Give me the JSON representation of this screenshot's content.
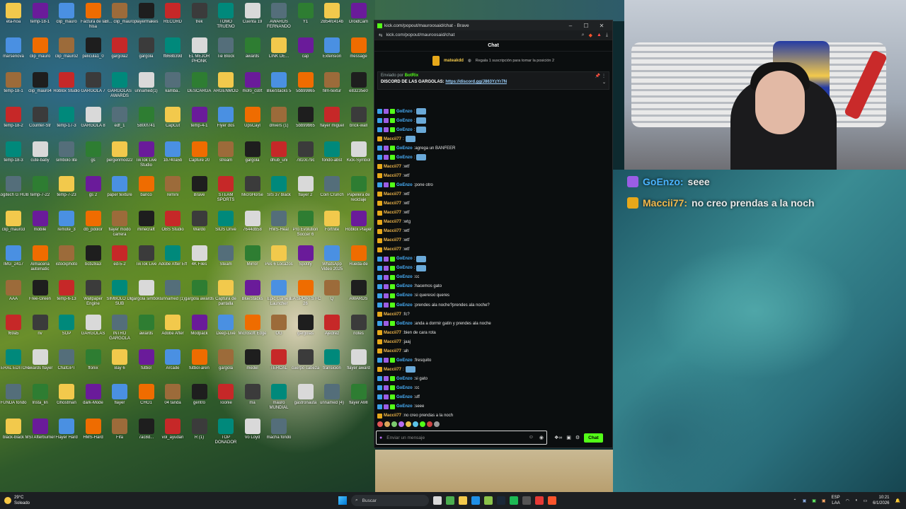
{
  "browser": {
    "window_title": "kick.com/popout/mauroosaid/chat - Brave",
    "url": "kick.com/popout/mauroosaid/chat",
    "chat_title": "Chat",
    "gift": {
      "user": "mateakdd",
      "text": "Regala 1 suscripción para tomar la posición 2"
    },
    "pinned": {
      "by_label": "Enviado por",
      "by_user": "BotRix",
      "text": "DISCORD DE LAS GARGOLAS:",
      "link": "https://discord.gg/J863YzYr7N"
    },
    "input_placeholder": "Enviar un mensaje",
    "send_label": "Chat"
  },
  "messages": [
    {
      "user": "GoEnzo",
      "color": "#4ab3ff",
      "text": "",
      "emote": true
    },
    {
      "user": "GoEnzo",
      "color": "#4ab3ff",
      "text": "",
      "emote": true
    },
    {
      "user": "GoEnzo",
      "color": "#4ab3ff",
      "text": "",
      "emote": true
    },
    {
      "user": "Maccii77",
      "color": "#f2b84b",
      "text": "",
      "emote": true
    },
    {
      "user": "GoEnzo",
      "color": "#4ab3ff",
      "text": "agrega un BANFEER",
      "emote": false
    },
    {
      "user": "GoEnzo",
      "color": "#4ab3ff",
      "text": "",
      "emote": true
    },
    {
      "user": "Maccii77",
      "color": "#f2b84b",
      "text": "wtf",
      "emote": false
    },
    {
      "user": "Maccii77",
      "color": "#f2b84b",
      "text": "wtf",
      "emote": false
    },
    {
      "user": "GoEnzo",
      "color": "#4ab3ff",
      "text": "pone otro",
      "emote": false
    },
    {
      "user": "Maccii77",
      "color": "#f2b84b",
      "text": "wtf",
      "emote": false
    },
    {
      "user": "Maccii77",
      "color": "#f2b84b",
      "text": "wtf",
      "emote": false
    },
    {
      "user": "Maccii77",
      "color": "#f2b84b",
      "text": "wtf",
      "emote": false
    },
    {
      "user": "Maccii77",
      "color": "#f2b84b",
      "text": "wtg",
      "emote": false
    },
    {
      "user": "Maccii77",
      "color": "#f2b84b",
      "text": "wtf",
      "emote": false
    },
    {
      "user": "Maccii77",
      "color": "#f2b84b",
      "text": "wtf",
      "emote": false
    },
    {
      "user": "Maccii77",
      "color": "#f2b84b",
      "text": "wtf",
      "emote": false
    },
    {
      "user": "GoEnzo",
      "color": "#4ab3ff",
      "text": "",
      "emote": true
    },
    {
      "user": "GoEnzo",
      "color": "#4ab3ff",
      "text": "",
      "emote": true
    },
    {
      "user": "GoEnzo",
      "color": "#4ab3ff",
      "text": "cc",
      "emote": false
    },
    {
      "user": "GoEnzo",
      "color": "#4ab3ff",
      "text": "hacemos gato",
      "emote": false
    },
    {
      "user": "GoEnzo",
      "color": "#4ab3ff",
      "text": "si queresxi queres",
      "emote": false
    },
    {
      "user": "GoEnzo",
      "color": "#4ab3ff",
      "text": "prendes ala noche?prendes ala noche?",
      "emote": false
    },
    {
      "user": "Maccii77",
      "color": "#f2b84b",
      "text": "fc?",
      "emote": false
    },
    {
      "user": "GoEnzo",
      "color": "#4ab3ff",
      "text": "anda a dormir gatin y prendes ala noche",
      "emote": false
    },
    {
      "user": "Maccii77",
      "color": "#f2b84b",
      "text": "bien de cara rota",
      "emote": false
    },
    {
      "user": "Maccii77",
      "color": "#f2b84b",
      "text": "jaaj",
      "emote": false
    },
    {
      "user": "Maccii77",
      "color": "#f2b84b",
      "text": "ah",
      "emote": false
    },
    {
      "user": "GoEnzo",
      "color": "#4ab3ff",
      "text": "fresquito",
      "emote": false
    },
    {
      "user": "Maccii77",
      "color": "#f2b84b",
      "text": "",
      "emote": true
    },
    {
      "user": "GoEnzo",
      "color": "#4ab3ff",
      "text": "si gato",
      "emote": false
    },
    {
      "user": "GoEnzo",
      "color": "#4ab3ff",
      "text": "cc",
      "emote": false
    },
    {
      "user": "GoEnzo",
      "color": "#4ab3ff",
      "text": "uff",
      "emote": false
    },
    {
      "user": "GoEnzo",
      "color": "#4ab3ff",
      "text": "seee",
      "emote": false
    },
    {
      "user": "Maccii77",
      "color": "#f2b84b",
      "text": "no creo  prendas a la noch",
      "emote": false
    }
  ],
  "overlay": [
    {
      "user": "GoEnzo:",
      "text": "seee",
      "color": "#4ab3ff"
    },
    {
      "user": "Maccii77:",
      "text": "no creo  prendas a la noch",
      "color": "#f2b84b"
    }
  ],
  "desktop_icons": [
    "eta-hoa",
    "temp-18-1",
    "clip_mauro",
    "Factura de la hisa",
    "Bl... clip_mauro",
    "playermakes",
    "RECORD",
    "trek",
    "TOMO TRUENO",
    "Cuenta 19",
    "AWARDS FERNANDO",
    "Y1",
    "2B54fc414b",
    "DroidCam",
    "marsenova",
    "clip_mauro",
    "clip_mauro2",
    "pelicula1_0",
    "gargola2",
    "gargola",
    "ff868b39d",
    "EL MEJOR PHONK",
    "Tie Block",
    "awards",
    "LINK DE...",
    "cap",
    "Extension",
    "message",
    "temp-18-1",
    "clip_mauro4",
    "Roblox Studio",
    "GARGOLA 7",
    "GARGOLAS AWARDS",
    "unnamed(1)",
    "kamba..",
    "DESCARGA",
    "ARGENMOD",
    "mofo_cstrt",
    "BlueStacks 5",
    "5bb99865",
    "film-textur",
    "e83235e0",
    "temp-18-2",
    "Counter-Str",
    "temp-17-3",
    "GARGOLA 8",
    "edf_1",
    "5800f741",
    "CapCut",
    "temp-4-1",
    "Flyer dos",
    "UpsCayl",
    "drivers (1)",
    "5bb99b65",
    "flayer miguel",
    "brick-wall",
    "temp-18-3",
    "cute-baby",
    "simbolo lite",
    "gs",
    "pergenmod22",
    "TikTok Live Studio",
    "1b740a5b",
    "Capture 20",
    "stream",
    "gargola",
    "dhub_uni",
    "7810c79c",
    "fondo-abst",
    "Kick-Symbol",
    "Logitech G HUB",
    "temp-7-22",
    "temp-7-23",
    "gs 2",
    "paper texture",
    "banco",
    "remini",
    "Brave",
    "STEAM SPORTS",
    "MicroHorse",
    "SIS 37 black",
    "flayer 2",
    "Coin Crunch",
    "Papelera de reciclaje",
    "clip_mauro3",
    "mobile",
    "remote_3",
    "db_pdolor",
    "flayer modo carrera",
    "minecraft",
    "OBS Studio",
    "Wardo",
    "SIDS Drive",
    "7644db58",
    "HMS-Heal",
    "Pro Evolution Soccer 6",
    "Fortnite",
    "Roblox Player",
    "IMG_2417",
    "Almacena automatic",
    "istockphoto",
    "bcb28a3",
    "ed-5-2",
    "TikTok Live",
    "Adobe After Eff",
    "4K Files",
    "Steam",
    "Mirror",
    "Pes 6 Locazos",
    "Spotify",
    "WhatsApp Video 2025",
    "Rueda-de",
    "AAA",
    "Free-Green",
    "temp-6-13",
    "Wallpaper Engine",
    "SIMBOLO DE SUB",
    "gargola simbolo",
    "unnamed (1)",
    "gargola awards",
    "Captura de pantalla",
    "BlueStacks",
    "Epic Games Launcher",
    "EA SPORTS FC 26",
    "Q",
    "AWARDS",
    "f69a5",
    "nv",
    "SOP",
    "GARGOLAS",
    "INTRO GARGOLA",
    "awards",
    "Adobe After",
    "Modpack",
    "Deep-Live",
    "Microsoft Edge",
    "OG",
    "gargolas",
    "Ajedrez",
    "notes",
    "TERAL EDITOR",
    "awards flayer",
    "ChatGPT",
    "ffonix",
    "Bay 6",
    "futbol",
    "Arcade",
    "futbol-aren",
    "gargola",
    "medel",
    "TERCAL",
    "cuerpo cabeza",
    "transicion",
    "flayer award",
    "FUNDA fondo",
    "Insta_lin",
    "Ghostman",
    "dark-Mode",
    "flayer",
    "CHO1",
    "04 tanda",
    "gentro",
    "Toonie",
    "ma",
    "mauro MUNDIAL",
    "gastronauta",
    "unnamed (4)",
    "flayer AMI",
    "black-black",
    "MSI Afterburner",
    "Flayer Hard",
    "HMS-Hard",
    "Fifa",
    "7ac8d...",
    "vol_ayudan",
    "R (1)",
    "TOP DONADOR",
    "Vo Loyd",
    "macha fondo"
  ],
  "taskbar": {
    "weather_temp": "29°C",
    "weather_desc": "Soleado",
    "search_placeholder": "Buscar",
    "lang": "ESP",
    "lang2": "LAA",
    "time": "10:21",
    "date": "6/1/2026"
  },
  "colors": {
    "kick_green": "#53fc18",
    "user_blue": "#4ab3ff",
    "user_gold": "#f2b84b"
  }
}
